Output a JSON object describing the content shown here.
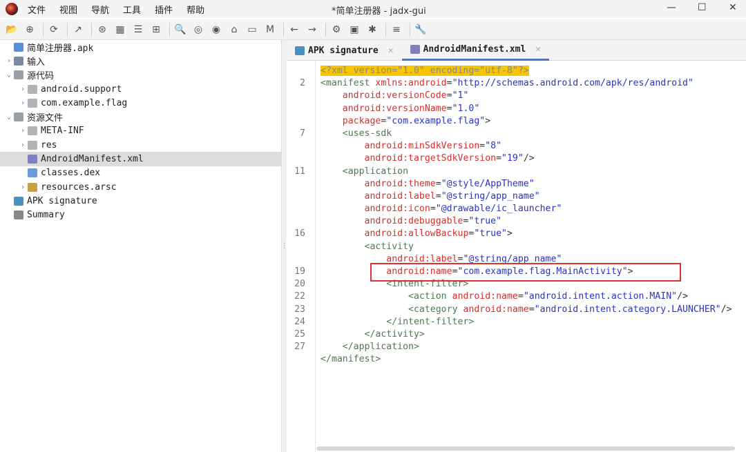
{
  "window": {
    "title": "*简单注册器 - jadx-gui",
    "minimize": "—",
    "maximize": "☐",
    "close": "✕"
  },
  "menu": [
    "文件",
    "视图",
    "导航",
    "工具",
    "插件",
    "帮助"
  ],
  "toolbar": [
    [
      "open-icon",
      "📂"
    ],
    [
      "add-files-icon",
      "⊕"
    ],
    "|",
    [
      "reload-icon",
      "⟳"
    ],
    "|",
    [
      "export-icon",
      "↗"
    ],
    "|",
    [
      "sync-icon",
      "⊛"
    ],
    [
      "flatten-packages-icon",
      "▦"
    ],
    [
      "text-view-icon",
      "☰"
    ],
    [
      "decompile-all-icon",
      "⊞"
    ],
    "|",
    [
      "search-icon",
      "🔍"
    ],
    [
      "find-class-icon",
      "◎"
    ],
    [
      "find-usage-icon",
      "◉"
    ],
    [
      "home-icon",
      "⌂"
    ],
    [
      "smali-icon",
      "▭"
    ],
    [
      "mapping-icon",
      "M"
    ],
    "|",
    [
      "back-icon",
      "←"
    ],
    [
      "forward-icon",
      "→"
    ],
    "|",
    [
      "deobfuscation-icon",
      "⚙"
    ],
    [
      "log-icon",
      "▣"
    ],
    [
      "debug-icon",
      "✱"
    ],
    "|",
    [
      "log-viewer-icon",
      "≡"
    ],
    "|",
    [
      "settings-icon",
      "🔧"
    ]
  ],
  "tree": [
    {
      "label": "简单注册器.apk",
      "depth": 0,
      "arrow": "",
      "icon": "#5a8fd8"
    },
    {
      "label": "输入",
      "depth": 0,
      "arrow": "›",
      "icon": "#7a8aa0"
    },
    {
      "label": "源代码",
      "depth": 0,
      "arrow": "⌄",
      "icon": "#9aa0a8"
    },
    {
      "label": "android.support",
      "depth": 1,
      "arrow": "›",
      "icon": "#b0b4ba"
    },
    {
      "label": "com.example.flag",
      "depth": 1,
      "arrow": "›",
      "icon": "#b0b4ba"
    },
    {
      "label": "资源文件",
      "depth": 0,
      "arrow": "⌄",
      "icon": "#9aa0a8"
    },
    {
      "label": "META-INF",
      "depth": 1,
      "arrow": "›",
      "icon": "#b0b4ba"
    },
    {
      "label": "res",
      "depth": 1,
      "arrow": "›",
      "icon": "#b0b4ba"
    },
    {
      "label": "AndroidManifest.xml",
      "depth": 1,
      "arrow": "",
      "icon": "#8080c0",
      "selected": true
    },
    {
      "label": "classes.dex",
      "depth": 1,
      "arrow": "",
      "icon": "#6a9ad8"
    },
    {
      "label": "resources.arsc",
      "depth": 1,
      "arrow": "›",
      "icon": "#c9a040"
    },
    {
      "label": "APK signature",
      "depth": 0,
      "arrow": "",
      "icon": "#4a90c0"
    },
    {
      "label": "Summary",
      "depth": 0,
      "arrow": "",
      "icon": "#888888"
    }
  ],
  "tabs": [
    {
      "label": "APK signature",
      "active": false
    },
    {
      "label": "AndroidManifest.xml",
      "active": true
    }
  ],
  "line_numbers": [
    "",
    "2",
    "",
    "",
    "",
    "7",
    "",
    "",
    "11",
    "",
    "",
    "",
    "",
    "16",
    "",
    "",
    "19",
    "20",
    "22",
    "23",
    "24",
    "25",
    "27"
  ],
  "code": [
    [
      [
        "decl",
        "<?xml version=\"1.0\" encoding=\"utf-8\"?>"
      ]
    ],
    [
      [
        "tag",
        "<manifest "
      ],
      [
        "attr",
        "xmlns:android"
      ],
      [
        "p",
        "="
      ],
      [
        "val",
        "\"http://schemas.android.com/apk/res/android\""
      ]
    ],
    [
      [
        "p",
        "    "
      ],
      [
        "attr",
        "android:versionCode"
      ],
      [
        "p",
        "="
      ],
      [
        "val",
        "\"1\""
      ]
    ],
    [
      [
        "p",
        "    "
      ],
      [
        "attr",
        "android:versionName"
      ],
      [
        "p",
        "="
      ],
      [
        "val",
        "\"1.0\""
      ]
    ],
    [
      [
        "p",
        "    "
      ],
      [
        "attr",
        "package"
      ],
      [
        "p",
        "="
      ],
      [
        "val",
        "\"com.example.flag\""
      ],
      [
        "p",
        ">"
      ]
    ],
    [
      [
        "p",
        "    "
      ],
      [
        "tag",
        "<uses-sdk"
      ]
    ],
    [
      [
        "p",
        "        "
      ],
      [
        "attr",
        "android:minSdkVersion"
      ],
      [
        "p",
        "="
      ],
      [
        "val",
        "\"8\""
      ]
    ],
    [
      [
        "p",
        "        "
      ],
      [
        "attr",
        "android:targetSdkVersion"
      ],
      [
        "p",
        "="
      ],
      [
        "val",
        "\"19\""
      ],
      [
        "p",
        "/>"
      ]
    ],
    [
      [
        "p",
        "    "
      ],
      [
        "tag",
        "<application"
      ]
    ],
    [
      [
        "p",
        "        "
      ],
      [
        "attr",
        "android:theme"
      ],
      [
        "p",
        "="
      ],
      [
        "val",
        "\"@style/AppTheme\""
      ]
    ],
    [
      [
        "p",
        "        "
      ],
      [
        "attr",
        "android:label"
      ],
      [
        "p",
        "="
      ],
      [
        "val",
        "\"@string/app_name\""
      ]
    ],
    [
      [
        "p",
        "        "
      ],
      [
        "attr",
        "android:icon"
      ],
      [
        "p",
        "="
      ],
      [
        "val",
        "\"@drawable/ic_launcher\""
      ]
    ],
    [
      [
        "p",
        "        "
      ],
      [
        "attr",
        "android:debuggable"
      ],
      [
        "p",
        "="
      ],
      [
        "val",
        "\"true\""
      ]
    ],
    [
      [
        "p",
        "        "
      ],
      [
        "attr",
        "android:allowBackup"
      ],
      [
        "p",
        "="
      ],
      [
        "val",
        "\"true\""
      ],
      [
        "p",
        ">"
      ]
    ],
    [
      [
        "p",
        "        "
      ],
      [
        "tag",
        "<activity"
      ]
    ],
    [
      [
        "p",
        "            "
      ],
      [
        "attr",
        "android:label"
      ],
      [
        "p",
        "="
      ],
      [
        "val",
        "\"@string/app_name\""
      ]
    ],
    [
      [
        "p",
        "            "
      ],
      [
        "attr",
        "android:name"
      ],
      [
        "p",
        "="
      ],
      [
        "val",
        "\"com.example.flag.MainActivity\""
      ],
      [
        "p",
        ">"
      ]
    ],
    [
      [
        "p",
        "            "
      ],
      [
        "tag",
        "<intent-filter>"
      ]
    ],
    [
      [
        "p",
        "                "
      ],
      [
        "tag",
        "<action "
      ],
      [
        "attr",
        "android:name"
      ],
      [
        "p",
        "="
      ],
      [
        "val",
        "\"android.intent.action.MAIN\""
      ],
      [
        "p",
        "/>"
      ]
    ],
    [
      [
        "p",
        "                "
      ],
      [
        "tag",
        "<category "
      ],
      [
        "attr",
        "android:name"
      ],
      [
        "p",
        "="
      ],
      [
        "val",
        "\"android.intent.category.LAUNCHER\""
      ],
      [
        "p",
        "/>"
      ]
    ],
    [
      [
        "p",
        "            "
      ],
      [
        "tag",
        "</intent-filter>"
      ]
    ],
    [
      [
        "p",
        "        "
      ],
      [
        "tag",
        "</activity>"
      ]
    ],
    [
      [
        "p",
        "    "
      ],
      [
        "tag",
        "</application>"
      ]
    ],
    [
      [
        "tag",
        "</manifest>"
      ]
    ]
  ],
  "highlight_color": "#e03030"
}
